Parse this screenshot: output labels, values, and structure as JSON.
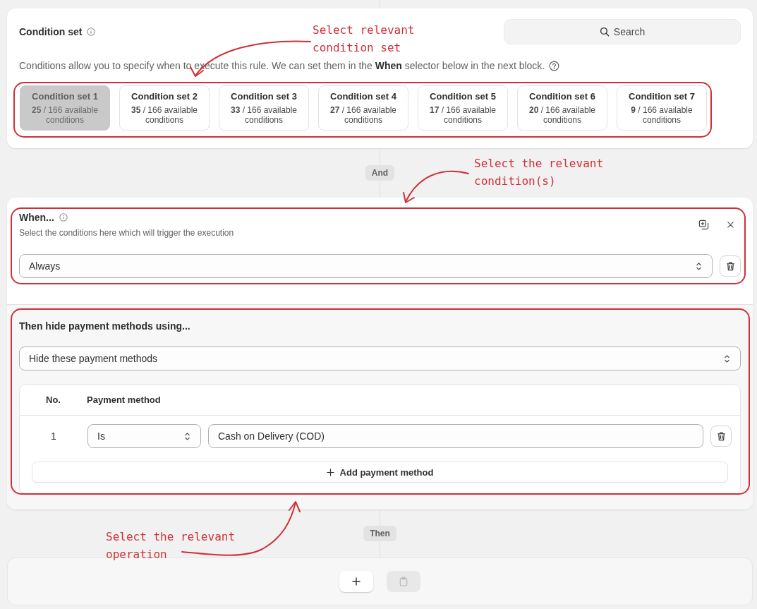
{
  "condition_set_card": {
    "title": "Condition set",
    "search": {
      "label": "Search"
    },
    "description": "Conditions allow you to specify when to execute this rule. We can set them in the **When** selector below in the next block.",
    "sets": [
      {
        "name": "Condition set 1",
        "available": "**25** / 166 available conditions",
        "selected": true
      },
      {
        "name": "Condition set 2",
        "available": "**35** / 166 available conditions",
        "selected": false
      },
      {
        "name": "Condition set 3",
        "available": "**33** / 166 available conditions",
        "selected": false
      },
      {
        "name": "Condition set 4",
        "available": "**27** / 166 available conditions",
        "selected": false
      },
      {
        "name": "Condition set 5",
        "available": "**17** / 166 available conditions",
        "selected": false
      },
      {
        "name": "Condition set 6",
        "available": "**20** / 166 available conditions",
        "selected": false
      },
      {
        "name": "Condition set 7",
        "available": "**9** / 166 available conditions",
        "selected": false
      }
    ]
  },
  "and_connector": {
    "label": "And"
  },
  "rule_card": {
    "when": {
      "title": "When...",
      "subtitle": "Select the conditions here which will trigger the execution",
      "select": {
        "value": "Always"
      }
    },
    "then": {
      "title": "Then hide payment methods using...",
      "select": {
        "value": "Hide these payment methods"
      },
      "table": {
        "columns": [
          "No.",
          "Payment method"
        ],
        "rows": [
          {
            "no": "1",
            "operator": "Is",
            "payment_method": "Cash on Delivery (COD)"
          }
        ]
      },
      "add_button": {
        "label": "Add payment method"
      }
    }
  },
  "then_connector": {
    "label": "Then"
  },
  "action_bar": {
    "buttons": [
      {
        "kind": "add",
        "disabled": false
      },
      {
        "kind": "paste",
        "disabled": true
      }
    ]
  },
  "annotations": [
    {
      "text": "Select relevant condition set"
    },
    {
      "text": "Select the relevant condition(s)"
    },
    {
      "text": "Select the relevant operation"
    }
  ]
}
